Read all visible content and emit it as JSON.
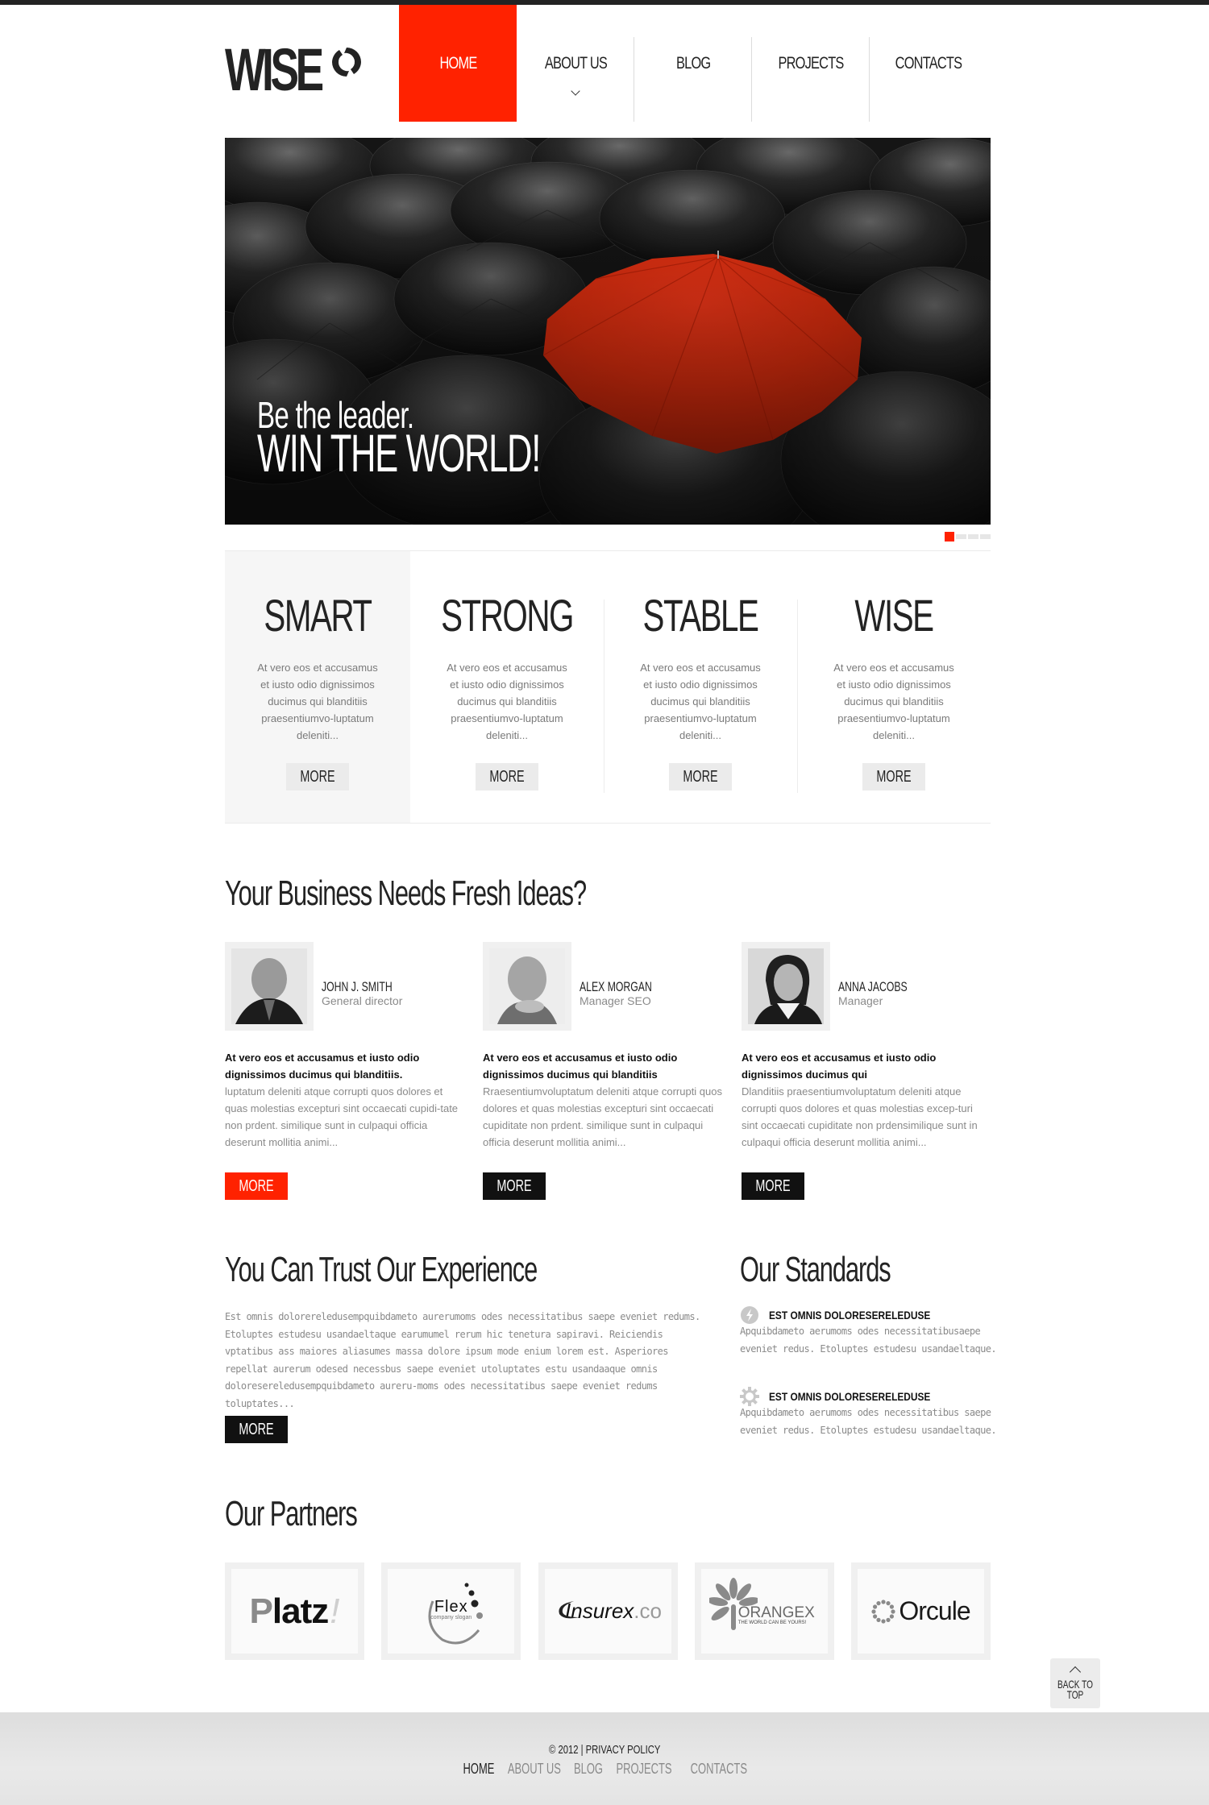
{
  "logo": {
    "text": "WISE"
  },
  "nav": {
    "items": [
      {
        "label": "HOME",
        "active": true
      },
      {
        "label": "ABOUT US",
        "has_submenu": true
      },
      {
        "label": "BLOG"
      },
      {
        "label": "PROJECTS"
      },
      {
        "label": "CONTACTS"
      }
    ]
  },
  "hero": {
    "line1": "Be the leader.",
    "line2": "WIN THE WORLD!",
    "slides": 4,
    "active_slide": 1
  },
  "features": [
    {
      "title": "SMART",
      "text": "At vero eos et accusamus et iusto odio dignissimos ducimus qui blanditiis praesentiumvo-luptatum deleniti...",
      "button": "MORE"
    },
    {
      "title": "STRONG",
      "text": "At vero eos et accusamus et iusto odio dignissimos ducimus qui blanditiis praesentiumvo-luptatum deleniti...",
      "button": "MORE"
    },
    {
      "title": "STABLE",
      "text": "At vero eos et accusamus et iusto odio dignissimos ducimus qui blanditiis praesentiumvo-luptatum deleniti...",
      "button": "MORE"
    },
    {
      "title": "WISE",
      "text": "At vero eos et accusamus et iusto odio dignissimos ducimus qui blanditiis praesentiumvo-luptatum deleniti...",
      "button": "MORE"
    }
  ],
  "team": {
    "heading": "Your Business Needs Fresh Ideas?",
    "members": [
      {
        "name": "JOHN J. SMITH",
        "role": "General director",
        "lead": "At vero eos et accusamus et iusto odio dignissimos ducimus qui blanditiis.",
        "body": "luptatum deleniti atque corrupti quos dolores et quas molestias excepturi sint occaecati cupidi-tate non prdent. similique sunt in culpaqui officia deserunt mollitia animi...",
        "button": "MORE"
      },
      {
        "name": "ALEX MORGAN",
        "role": "Manager SEO",
        "lead": "At vero eos et accusamus et iusto odio dignissimos ducimus qui blanditiis",
        "body": "Rraesentiumvoluptatum deleniti atque corrupti quos dolores et quas molestias excepturi sint occaecati cupiditate non prdent. similique sunt in culpaqui officia deserunt mollitia animi...",
        "button": "MORE"
      },
      {
        "name": "ANNA JACOBS",
        "role": "Manager",
        "lead": "At vero eos et accusamus et iusto odio dignissimos ducimus qui",
        "body": "Dlanditiis praesentiumvoluptatum deleniti atque corrupti quos dolores et quas molestias excep-turi sint occaecati cupiditate non prdensimilique sunt in culpaqui officia deserunt mollitia animi...",
        "button": "MORE"
      }
    ]
  },
  "trust": {
    "heading": "You Can Trust Our Experience",
    "text": "Est omnis dolorereledusempquibdameto aurerumoms odes necessitatibus saepe eveniet redums. Etoluptes estudesu usandaeltaque earumumel rerum hic tenetura sapiravi. Reiciendis vptatibus ass maiores aliasumes massa dolore ipsum mode enium lorem est. Asperiores repellat aurerum odesed necessbus saepe eveniet utoluptates estu usandaaque omnis doloresereledusempquibdameto aureru-moms odes necessitatibus saepe eveniet redums toluptates...",
    "button": "MORE"
  },
  "standards": {
    "heading": "Our Standards",
    "items": [
      {
        "icon": "refresh-icon",
        "title": "EST OMNIS DOLORESERELEDUSE",
        "text": "Apquibdameto aerumoms odes necessitatibusaepe eveniet redus. Etoluptes estudesu usandaeltaque."
      },
      {
        "icon": "gear-icon",
        "title": "EST OMNIS DOLORESERELEDUSE",
        "text": "Apquibdameto aerumoms odes necessitatibus saepe eveniet redus. Etoluptes estudesu usandaeltaque."
      }
    ]
  },
  "partners": {
    "heading": "Our Partners",
    "logos": [
      {
        "name": "Platz",
        "mark": "!"
      },
      {
        "name": "Flex",
        "slogan": "company slogan"
      },
      {
        "name": "Insurex",
        "suffix": ".co"
      },
      {
        "name": "ORANGEX",
        "slogan": "THE WORLD CAN BE YOURS!"
      },
      {
        "name": "Orcule"
      }
    ]
  },
  "back_to_top": {
    "label": "BACK TO TOP"
  },
  "footer": {
    "copyright": "© 2012 | PRIVACY POLICY",
    "links": [
      {
        "label": "HOME",
        "active": true
      },
      {
        "label": "ABOUT US"
      },
      {
        "label": "BLOG"
      },
      {
        "label": "PROJECTS"
      },
      {
        "label": "CONTACTS"
      }
    ]
  },
  "colors": {
    "accent": "#ff2200",
    "dark": "#232323",
    "muted_text": "#8a8a8a",
    "light_bg": "#f6f6f6"
  }
}
